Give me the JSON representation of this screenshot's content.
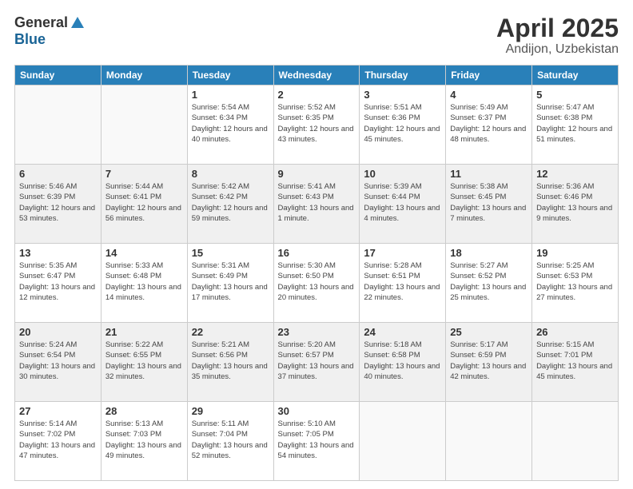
{
  "logo": {
    "general": "General",
    "blue": "Blue"
  },
  "title": "April 2025",
  "subtitle": "Andijon, Uzbekistan",
  "header_days": [
    "Sunday",
    "Monday",
    "Tuesday",
    "Wednesday",
    "Thursday",
    "Friday",
    "Saturday"
  ],
  "weeks": [
    [
      {
        "day": "",
        "empty": true
      },
      {
        "day": "",
        "empty": true
      },
      {
        "day": "1",
        "sunrise": "Sunrise: 5:54 AM",
        "sunset": "Sunset: 6:34 PM",
        "daylight": "Daylight: 12 hours and 40 minutes."
      },
      {
        "day": "2",
        "sunrise": "Sunrise: 5:52 AM",
        "sunset": "Sunset: 6:35 PM",
        "daylight": "Daylight: 12 hours and 43 minutes."
      },
      {
        "day": "3",
        "sunrise": "Sunrise: 5:51 AM",
        "sunset": "Sunset: 6:36 PM",
        "daylight": "Daylight: 12 hours and 45 minutes."
      },
      {
        "day": "4",
        "sunrise": "Sunrise: 5:49 AM",
        "sunset": "Sunset: 6:37 PM",
        "daylight": "Daylight: 12 hours and 48 minutes."
      },
      {
        "day": "5",
        "sunrise": "Sunrise: 5:47 AM",
        "sunset": "Sunset: 6:38 PM",
        "daylight": "Daylight: 12 hours and 51 minutes."
      }
    ],
    [
      {
        "day": "6",
        "sunrise": "Sunrise: 5:46 AM",
        "sunset": "Sunset: 6:39 PM",
        "daylight": "Daylight: 12 hours and 53 minutes."
      },
      {
        "day": "7",
        "sunrise": "Sunrise: 5:44 AM",
        "sunset": "Sunset: 6:41 PM",
        "daylight": "Daylight: 12 hours and 56 minutes."
      },
      {
        "day": "8",
        "sunrise": "Sunrise: 5:42 AM",
        "sunset": "Sunset: 6:42 PM",
        "daylight": "Daylight: 12 hours and 59 minutes."
      },
      {
        "day": "9",
        "sunrise": "Sunrise: 5:41 AM",
        "sunset": "Sunset: 6:43 PM",
        "daylight": "Daylight: 13 hours and 1 minute."
      },
      {
        "day": "10",
        "sunrise": "Sunrise: 5:39 AM",
        "sunset": "Sunset: 6:44 PM",
        "daylight": "Daylight: 13 hours and 4 minutes."
      },
      {
        "day": "11",
        "sunrise": "Sunrise: 5:38 AM",
        "sunset": "Sunset: 6:45 PM",
        "daylight": "Daylight: 13 hours and 7 minutes."
      },
      {
        "day": "12",
        "sunrise": "Sunrise: 5:36 AM",
        "sunset": "Sunset: 6:46 PM",
        "daylight": "Daylight: 13 hours and 9 minutes."
      }
    ],
    [
      {
        "day": "13",
        "sunrise": "Sunrise: 5:35 AM",
        "sunset": "Sunset: 6:47 PM",
        "daylight": "Daylight: 13 hours and 12 minutes."
      },
      {
        "day": "14",
        "sunrise": "Sunrise: 5:33 AM",
        "sunset": "Sunset: 6:48 PM",
        "daylight": "Daylight: 13 hours and 14 minutes."
      },
      {
        "day": "15",
        "sunrise": "Sunrise: 5:31 AM",
        "sunset": "Sunset: 6:49 PM",
        "daylight": "Daylight: 13 hours and 17 minutes."
      },
      {
        "day": "16",
        "sunrise": "Sunrise: 5:30 AM",
        "sunset": "Sunset: 6:50 PM",
        "daylight": "Daylight: 13 hours and 20 minutes."
      },
      {
        "day": "17",
        "sunrise": "Sunrise: 5:28 AM",
        "sunset": "Sunset: 6:51 PM",
        "daylight": "Daylight: 13 hours and 22 minutes."
      },
      {
        "day": "18",
        "sunrise": "Sunrise: 5:27 AM",
        "sunset": "Sunset: 6:52 PM",
        "daylight": "Daylight: 13 hours and 25 minutes."
      },
      {
        "day": "19",
        "sunrise": "Sunrise: 5:25 AM",
        "sunset": "Sunset: 6:53 PM",
        "daylight": "Daylight: 13 hours and 27 minutes."
      }
    ],
    [
      {
        "day": "20",
        "sunrise": "Sunrise: 5:24 AM",
        "sunset": "Sunset: 6:54 PM",
        "daylight": "Daylight: 13 hours and 30 minutes."
      },
      {
        "day": "21",
        "sunrise": "Sunrise: 5:22 AM",
        "sunset": "Sunset: 6:55 PM",
        "daylight": "Daylight: 13 hours and 32 minutes."
      },
      {
        "day": "22",
        "sunrise": "Sunrise: 5:21 AM",
        "sunset": "Sunset: 6:56 PM",
        "daylight": "Daylight: 13 hours and 35 minutes."
      },
      {
        "day": "23",
        "sunrise": "Sunrise: 5:20 AM",
        "sunset": "Sunset: 6:57 PM",
        "daylight": "Daylight: 13 hours and 37 minutes."
      },
      {
        "day": "24",
        "sunrise": "Sunrise: 5:18 AM",
        "sunset": "Sunset: 6:58 PM",
        "daylight": "Daylight: 13 hours and 40 minutes."
      },
      {
        "day": "25",
        "sunrise": "Sunrise: 5:17 AM",
        "sunset": "Sunset: 6:59 PM",
        "daylight": "Daylight: 13 hours and 42 minutes."
      },
      {
        "day": "26",
        "sunrise": "Sunrise: 5:15 AM",
        "sunset": "Sunset: 7:01 PM",
        "daylight": "Daylight: 13 hours and 45 minutes."
      }
    ],
    [
      {
        "day": "27",
        "sunrise": "Sunrise: 5:14 AM",
        "sunset": "Sunset: 7:02 PM",
        "daylight": "Daylight: 13 hours and 47 minutes."
      },
      {
        "day": "28",
        "sunrise": "Sunrise: 5:13 AM",
        "sunset": "Sunset: 7:03 PM",
        "daylight": "Daylight: 13 hours and 49 minutes."
      },
      {
        "day": "29",
        "sunrise": "Sunrise: 5:11 AM",
        "sunset": "Sunset: 7:04 PM",
        "daylight": "Daylight: 13 hours and 52 minutes."
      },
      {
        "day": "30",
        "sunrise": "Sunrise: 5:10 AM",
        "sunset": "Sunset: 7:05 PM",
        "daylight": "Daylight: 13 hours and 54 minutes."
      },
      {
        "day": "",
        "empty": true
      },
      {
        "day": "",
        "empty": true
      },
      {
        "day": "",
        "empty": true
      }
    ]
  ]
}
